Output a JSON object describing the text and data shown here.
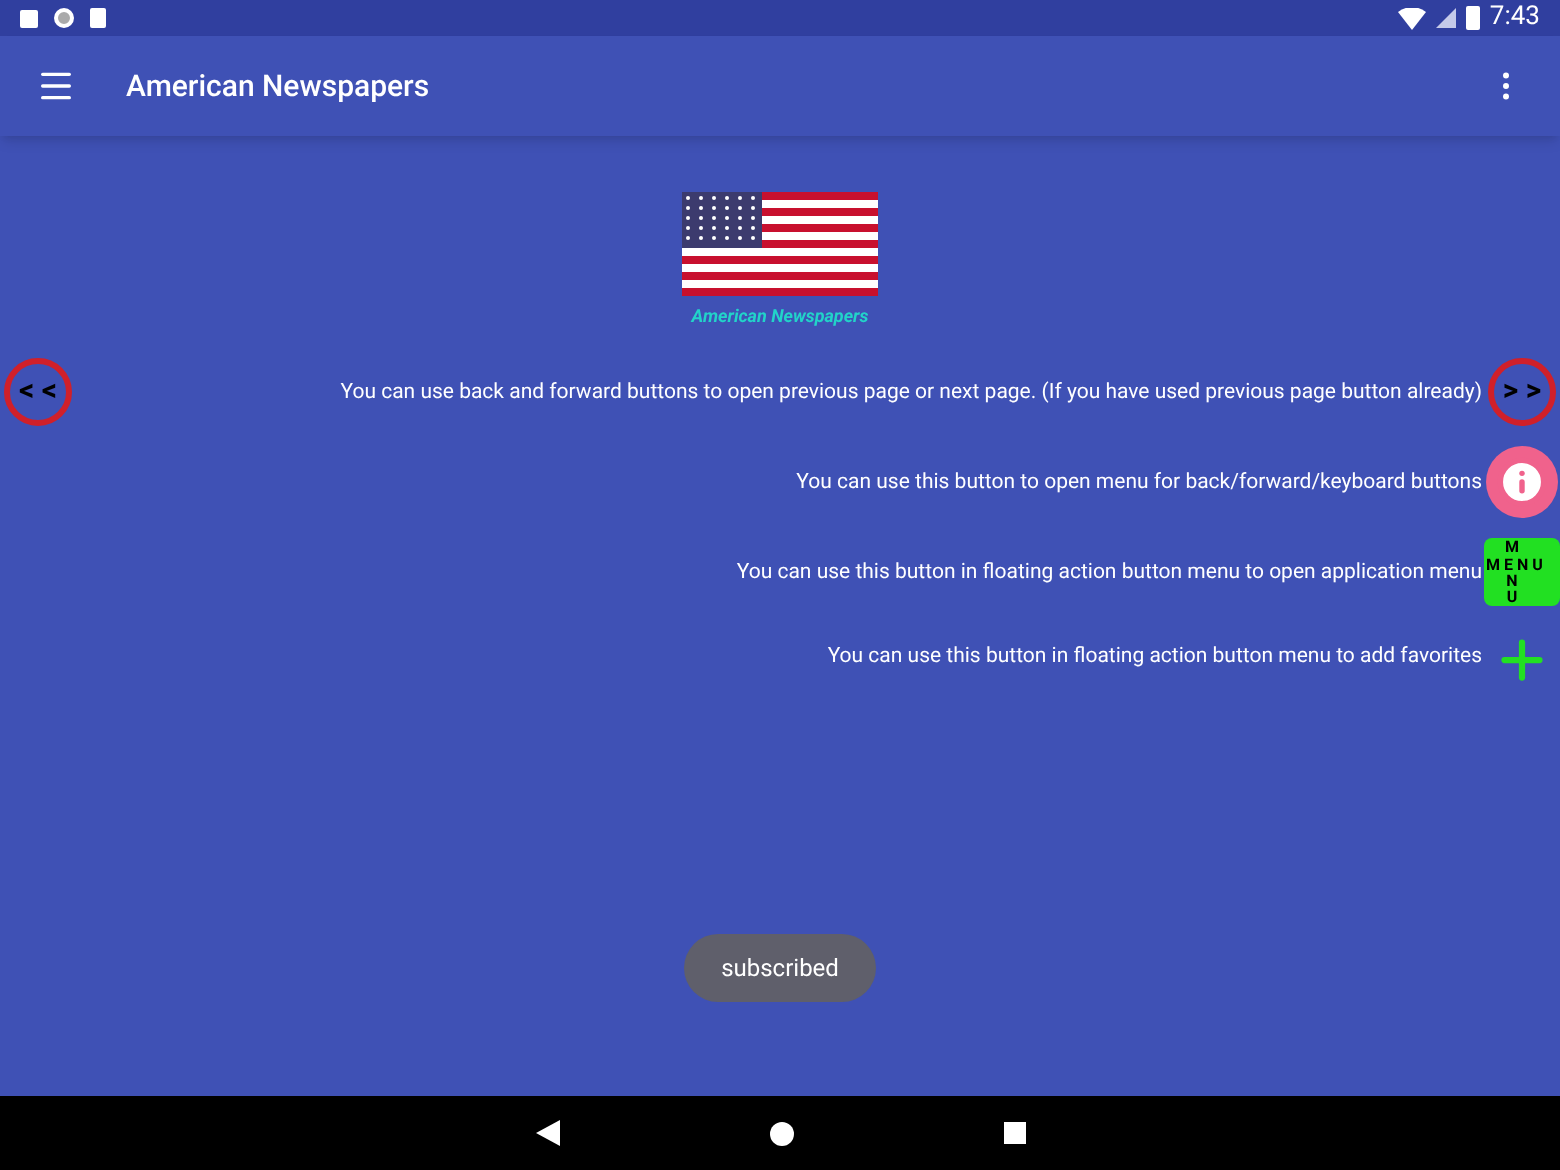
{
  "status_bar": {
    "time": "7:43"
  },
  "toolbar": {
    "title": "American Newspapers"
  },
  "logo": {
    "caption": "American Newspapers"
  },
  "hints": [
    {
      "kind": "nav",
      "back": "< <",
      "text": "You can use back and forward buttons to open previous page or next page. (If you have used previous page button already)",
      "forward": "> >"
    },
    {
      "kind": "info",
      "text": "You can use this button to open menu for back/forward/keyboard buttons"
    },
    {
      "kind": "menu",
      "text": "You can use this button in floating action button menu to open application menu",
      "horizontal": "M E N U",
      "vertical_top": "M",
      "vertical_bottom": "NU"
    },
    {
      "kind": "add",
      "text": "You can use this button in floating action button menu to add favorites"
    }
  ],
  "toast": "subscribed"
}
